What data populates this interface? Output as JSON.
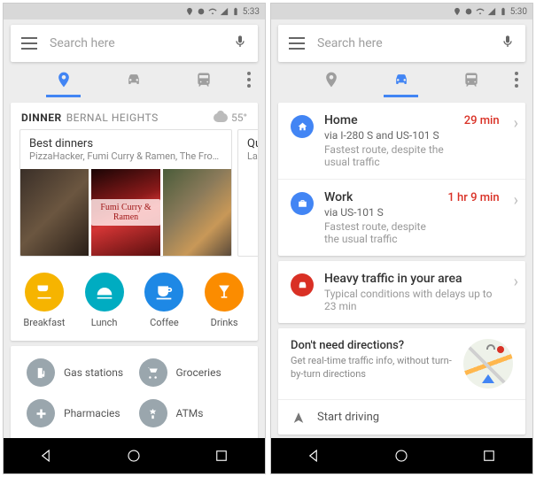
{
  "left": {
    "status_time": "5:33",
    "search_placeholder": "Search here",
    "dinner": {
      "category": "DINNER",
      "location": "BERNAL HEIGHTS",
      "temp": "55°",
      "best_title": "Best dinners",
      "best_sub": "PizzaHacker, Fumi Curry & Ramen, The Front...",
      "sign": "Fumi Curry & Ramen",
      "peek_title": "Quick",
      "peek_sub": "La Alt"
    },
    "cats": {
      "breakfast": "Breakfast",
      "lunch": "Lunch",
      "coffee": "Coffee",
      "drinks": "Drinks"
    },
    "services": {
      "gas": "Gas stations",
      "groceries": "Groceries",
      "pharmacies": "Pharmacies",
      "atms": "ATMs"
    }
  },
  "right": {
    "status_time": "5:30",
    "search_placeholder": "Search here",
    "home": {
      "title": "Home",
      "via": "via I-280 S and US-101 S",
      "desc": "Fastest route, despite the usual traffic",
      "time": "29 min"
    },
    "work": {
      "title": "Work",
      "via": "via US-101 S",
      "desc": "Fastest route, despite the usual traffic",
      "time": "1 hr 9 min"
    },
    "traffic": {
      "title": "Heavy traffic in your area",
      "desc": "Typical conditions with delays up to 23 min"
    },
    "nd": {
      "title": "Don't need directions?",
      "desc": "Get real-time traffic info, without turn-by-turn directions"
    },
    "start": "Start driving"
  }
}
